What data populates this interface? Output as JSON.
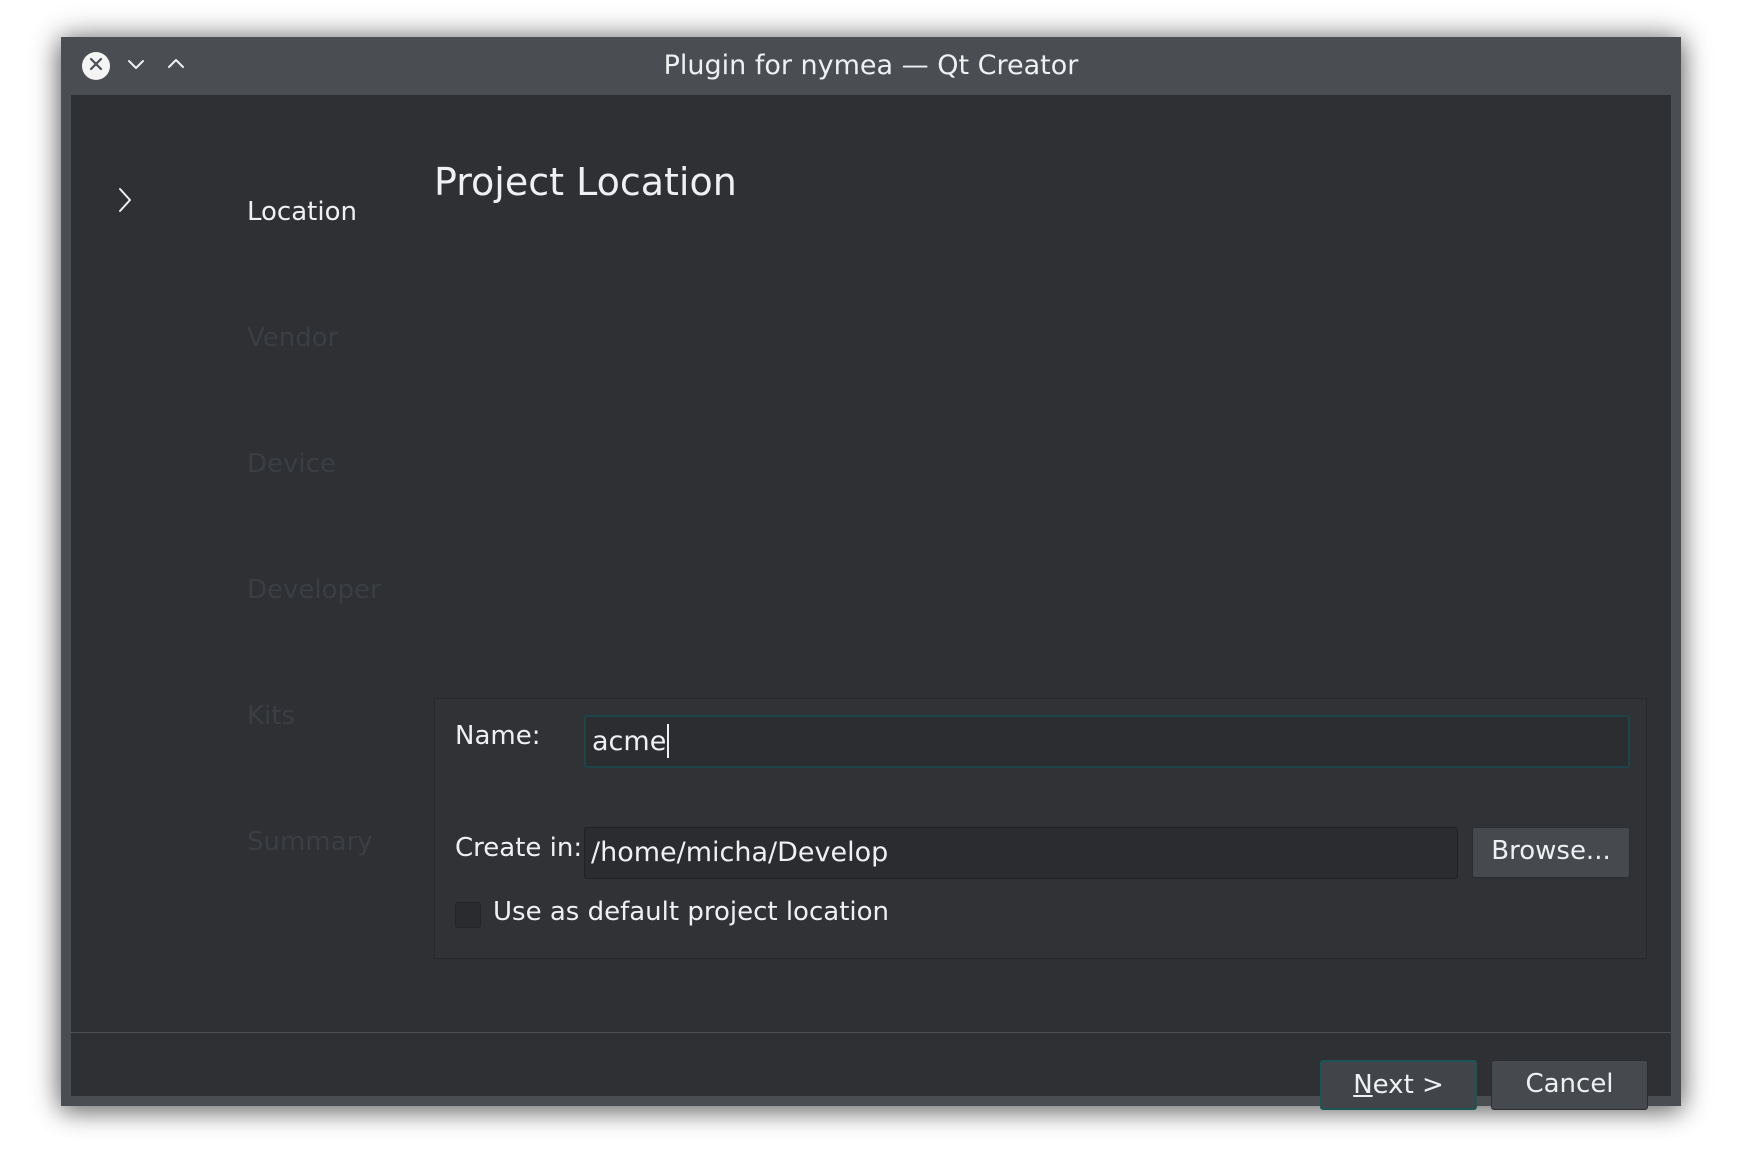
{
  "window": {
    "title": "Plugin for nymea — Qt Creator"
  },
  "titlebar": {
    "icons": [
      "close-icon",
      "minimize-icon",
      "maximize-icon"
    ]
  },
  "sidebar": {
    "items": [
      {
        "label": "Location",
        "active": true
      },
      {
        "label": "Vendor",
        "active": false
      },
      {
        "label": "Device",
        "active": false
      },
      {
        "label": "Developer",
        "active": false
      },
      {
        "label": "Kits",
        "active": false
      },
      {
        "label": "Summary",
        "active": false
      }
    ]
  },
  "page": {
    "title": "Project Location"
  },
  "form": {
    "name_label": "Name:",
    "name_value": "acme",
    "create_in_label": "Create in:",
    "create_in_value": "/home/micha/Develop",
    "browse_label": "Browse...",
    "default_location_label": "Use as default project location",
    "default_location_checked": false
  },
  "footer": {
    "next_mnemonic": "N",
    "next_rest": "ext >",
    "cancel_label": "Cancel"
  },
  "colors": {
    "titlebar": "#4a4e52",
    "background": "#2e3033",
    "text": "#eff0f1",
    "inactive_text": "#3b3e42",
    "focus_border": "#1d4448"
  }
}
